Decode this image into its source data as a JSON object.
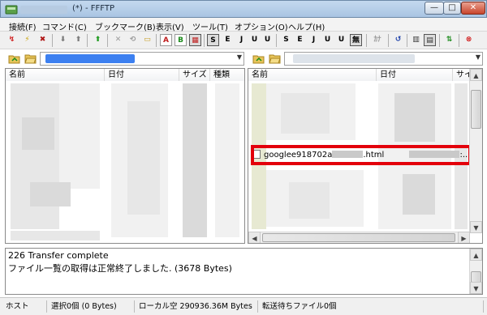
{
  "window": {
    "title": "(*) - FFFTP",
    "min_glyph": "—",
    "max_glyph": "□",
    "close_glyph": "✕"
  },
  "menu": [
    {
      "label": "接続(F)"
    },
    {
      "label": "コマンド(C)"
    },
    {
      "label": "ブックマーク(B)"
    },
    {
      "label": "表示(V)"
    },
    {
      "label": "ツール(T)"
    },
    {
      "label": "オプション(O)"
    },
    {
      "label": "ヘルプ(H)"
    }
  ],
  "toolbar": {
    "buttons": [
      {
        "name": "connect-icon",
        "glyph": "↯",
        "color": "#d02020"
      },
      {
        "name": "quick-connect-icon",
        "glyph": "⚡",
        "color": "#c7a000"
      },
      {
        "name": "disconnect-icon",
        "glyph": "✖",
        "color": "#b01818"
      },
      {
        "name": "download-icon",
        "glyph": "⬇",
        "color": "#7a7a7a"
      },
      {
        "name": "upload-icon",
        "glyph": "⬆",
        "color": "#7a7a7a"
      },
      {
        "name": "mirror-upload-icon",
        "glyph": "⬆",
        "color": "#1e9a1e"
      },
      {
        "name": "delete-icon",
        "glyph": "✕",
        "color": "#9a9a9a"
      },
      {
        "name": "rename-icon",
        "glyph": "⟲",
        "color": "#9a9a9a"
      },
      {
        "name": "new-folder-icon",
        "glyph": "▭",
        "color": "#c59a1a"
      },
      {
        "name": "ascii-mode-icon",
        "glyph": "A",
        "color": "#c02020"
      },
      {
        "name": "binary-mode-icon",
        "glyph": "B",
        "color": "#1a8a1a"
      },
      {
        "name": "auto-mode-icon",
        "glyph": "▦",
        "color": "#c02020"
      },
      {
        "name": "sjis-icon",
        "glyph": "S",
        "color": "#000000"
      },
      {
        "name": "euc-icon",
        "glyph": "E",
        "color": "#000000"
      },
      {
        "name": "jis-icon",
        "glyph": "J",
        "color": "#000000"
      },
      {
        "name": "utf8n-icon",
        "glyph": "U",
        "color": "#000000"
      },
      {
        "name": "utf8-icon",
        "glyph": "U",
        "color": "#000000"
      },
      {
        "name": "local-sjis-icon",
        "glyph": "S",
        "color": "#000000"
      },
      {
        "name": "local-euc-icon",
        "glyph": "E",
        "color": "#000000"
      },
      {
        "name": "local-jis-icon",
        "glyph": "J",
        "color": "#000000"
      },
      {
        "name": "local-utf8n-icon",
        "glyph": "U",
        "color": "#000000"
      },
      {
        "name": "local-utf8-icon",
        "glyph": "U",
        "color": "#000000"
      },
      {
        "name": "no-convert-icon",
        "glyph": "無",
        "color": "#000000"
      },
      {
        "name": "kana-convert-icon",
        "glyph": "ｶﾅ",
        "color": "#9a9a9a"
      },
      {
        "name": "refresh-icon",
        "glyph": "↺",
        "color": "#1a3ea8"
      },
      {
        "name": "list-view-icon",
        "glyph": "▥",
        "color": "#333333"
      },
      {
        "name": "detail-view-icon",
        "glyph": "▤",
        "color": "#333333"
      },
      {
        "name": "sync-folder-icon",
        "glyph": "⇅",
        "color": "#1a8a1a"
      },
      {
        "name": "stop-icon",
        "glyph": "⊗",
        "color": "#d01010"
      }
    ]
  },
  "local_pane": {
    "address_arrow": "▼",
    "columns": [
      "名前",
      "日付",
      "サイズ",
      "種類"
    ]
  },
  "remote_pane": {
    "address_arrow": "▼",
    "columns": [
      "名前",
      "日付",
      "サイ"
    ],
    "highlighted_file": {
      "name_prefix": "googlee918702a",
      "name_suffix": ".html",
      "date_tail": ":..."
    },
    "scroll_up": "▲",
    "scroll_down": "▼",
    "scroll_left": "◀",
    "scroll_right": "▶"
  },
  "log": {
    "lines": [
      "226 Transfer complete",
      "ファイル一覧の取得は正常終了しました. (3678 Bytes)"
    ],
    "scroll_up": "▲",
    "scroll_down": "▼"
  },
  "status": {
    "host": "ホスト",
    "selected": "選択0個 (0 Bytes)",
    "local_free": "ローカル空 290936.36M Bytes",
    "queue": "転送待ちファイル0個"
  },
  "colors": {
    "highlight_border": "#e3000b",
    "address_blue": "#3d80f0"
  }
}
